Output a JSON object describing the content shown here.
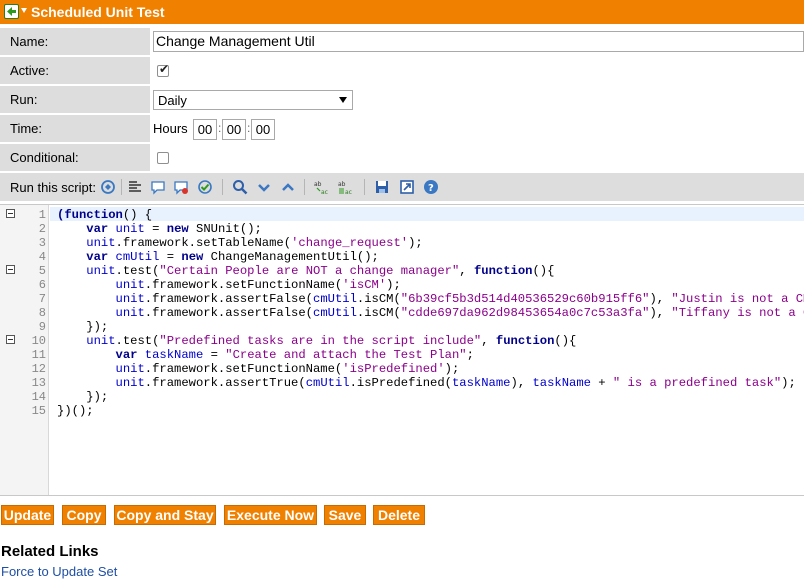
{
  "title": "Scheduled Unit Test",
  "form": {
    "name_label": "Name:",
    "name_value": "Change Management Util",
    "active_label": "Active:",
    "active_checked": true,
    "run_label": "Run:",
    "run_value": "Daily",
    "time_label": "Time:",
    "time_unit": "Hours",
    "time_hours": "00",
    "time_minutes": "00",
    "time_seconds": "00",
    "conditional_label": "Conditional:",
    "conditional_checked": false
  },
  "script_toolbar": {
    "label": "Run this script:",
    "icons": [
      "script-debug-icon",
      "format-code-icon",
      "comment-icon",
      "uncomment-icon",
      "check-syntax-icon",
      "search-icon",
      "next-icon",
      "previous-icon",
      "replace-icon",
      "replace-all-icon",
      "save-icon",
      "fullscreen-icon",
      "help-icon"
    ]
  },
  "editor": {
    "lines": [
      {
        "num": "1",
        "fold": true
      },
      {
        "num": "2",
        "fold": false
      },
      {
        "num": "3",
        "fold": false
      },
      {
        "num": "4",
        "fold": false
      },
      {
        "num": "5",
        "fold": true
      },
      {
        "num": "6",
        "fold": false
      },
      {
        "num": "7",
        "fold": false
      },
      {
        "num": "8",
        "fold": false
      },
      {
        "num": "9",
        "fold": false
      },
      {
        "num": "10",
        "fold": true
      },
      {
        "num": "11",
        "fold": false
      },
      {
        "num": "12",
        "fold": false
      },
      {
        "num": "13",
        "fold": false
      },
      {
        "num": "14",
        "fold": false
      },
      {
        "num": "15",
        "fold": false
      }
    ],
    "code": {
      "l1a": "(function",
      "l1b": "() {",
      "l2a": "    ",
      "l2b": "var",
      "l2c": " unit",
      "l2d": " = ",
      "l2e": "new",
      "l2f": " SNUnit();",
      "l3a": "    ",
      "l3b": "unit",
      "l3c": ".framework.setTableName(",
      "l3d": "'change_request'",
      "l3e": ");",
      "l4a": "    ",
      "l4b": "var",
      "l4c": " cmUtil",
      "l4d": " = ",
      "l4e": "new",
      "l4f": " ChangeManagementUtil();",
      "l5a": "    ",
      "l5b": "unit",
      "l5c": ".test(",
      "l5d": "\"Certain People are NOT a change manager\"",
      "l5e": ", ",
      "l5f": "function",
      "l5g": "(){",
      "l6a": "        ",
      "l6b": "unit",
      "l6c": ".framework.setFunctionName(",
      "l6d": "'isCM'",
      "l6e": ");",
      "l7a": "        ",
      "l7b": "unit",
      "l7c": ".framework.assertFalse(",
      "l7d": "cmUtil",
      "l7e": ".isCM(",
      "l7f": "\"6b39cf5b3d514d40536529c60b915ff6\"",
      "l7g": "), ",
      "l7h": "\"Justin is not a CM\"",
      "l7i": ");",
      "l8a": "        ",
      "l8b": "unit",
      "l8c": ".framework.assertFalse(",
      "l8d": "cmUtil",
      "l8e": ".isCM(",
      "l8f": "\"cdde697da962d98453654a0c7c53a3fa\"",
      "l8g": "), ",
      "l8h": "\"Tiffany is not a CM\"",
      "l8i": ");",
      "l9a": "    });",
      "l10a": "    ",
      "l10b": "unit",
      "l10c": ".test(",
      "l10d": "\"Predefined tasks are in the script include\"",
      "l10e": ", ",
      "l10f": "function",
      "l10g": "(){",
      "l11a": "        ",
      "l11b": "var",
      "l11c": " taskName",
      "l11d": " = ",
      "l11e": "\"Create and attach the Test Plan\"",
      "l11f": ";",
      "l12a": "        ",
      "l12b": "unit",
      "l12c": ".framework.setFunctionName(",
      "l12d": "'isPredefined'",
      "l12e": ");",
      "l13a": "        ",
      "l13b": "unit",
      "l13c": ".framework.assertTrue(",
      "l13d": "cmUtil",
      "l13e": ".isPredefined(",
      "l13f": "taskName",
      "l13g": "), ",
      "l13h": "taskName",
      "l13i": " + ",
      "l13j": "\" is a predefined task\"",
      "l13k": ");",
      "l14a": "    });",
      "l15a": "})();"
    }
  },
  "buttons": {
    "update": "Update",
    "copy": "Copy",
    "copy_and_stay": "Copy and Stay",
    "execute_now": "Execute Now",
    "save": "Save",
    "delete": "Delete"
  },
  "related": {
    "title": "Related Links",
    "link_force_update_set": "Force to Update Set"
  },
  "colors": {
    "accent": "#f08000",
    "label_bg": "#dddddd",
    "link": "#1f4fa3",
    "keyword": "#00008b",
    "variable": "#0000cc",
    "string": "#8b008b"
  }
}
